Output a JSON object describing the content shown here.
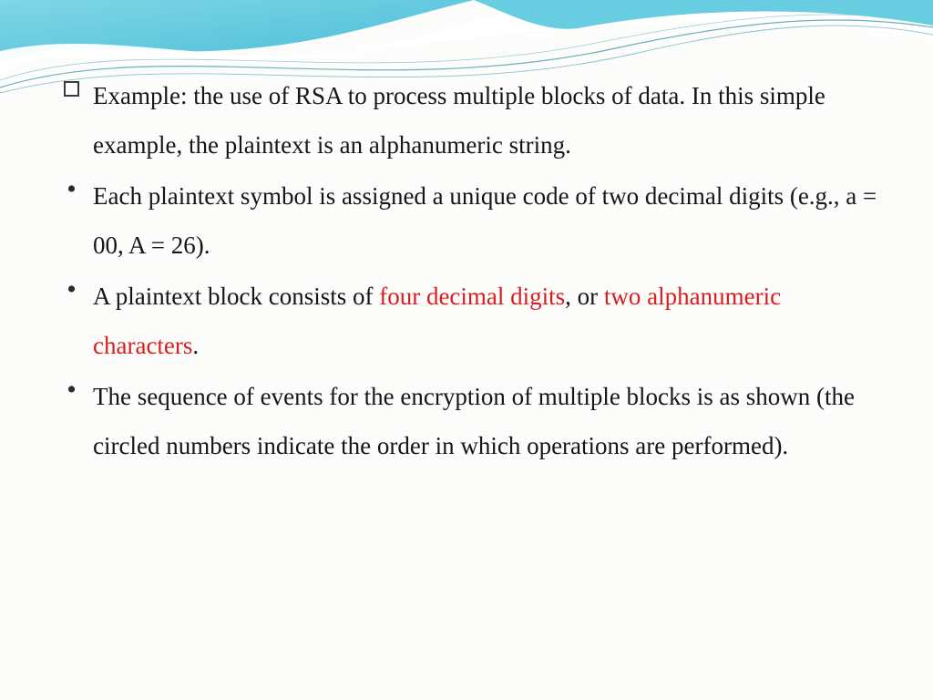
{
  "colors": {
    "highlight": "#d81e1e",
    "wave_primary": "#5bc7dd",
    "wave_light": "#b8e6ef",
    "wave_line": "#1a6e7a"
  },
  "bullets": [
    {
      "marker": "square",
      "segments": [
        {
          "text": "Example: the use of RSA to process multiple blocks of data. In this simple example, the plaintext is an alphanumeric string.",
          "highlight": false
        }
      ]
    },
    {
      "marker": "dot",
      "segments": [
        {
          "text": "Each plaintext symbol is assigned a unique code of two decimal digits (e.g., a = 00, A = 26).",
          "highlight": false
        }
      ]
    },
    {
      "marker": "dot",
      "segments": [
        {
          "text": " A plaintext block consists of ",
          "highlight": false
        },
        {
          "text": "four decimal digits",
          "highlight": true
        },
        {
          "text": ", or ",
          "highlight": false
        },
        {
          "text": "two alphanumeric characters",
          "highlight": true
        },
        {
          "text": ".",
          "highlight": false
        }
      ]
    },
    {
      "marker": "dot",
      "segments": [
        {
          "text": "The sequence of events for the encryption of multiple blocks is as shown (the circled numbers indicate the order in which operations are performed).",
          "highlight": false
        }
      ]
    }
  ]
}
